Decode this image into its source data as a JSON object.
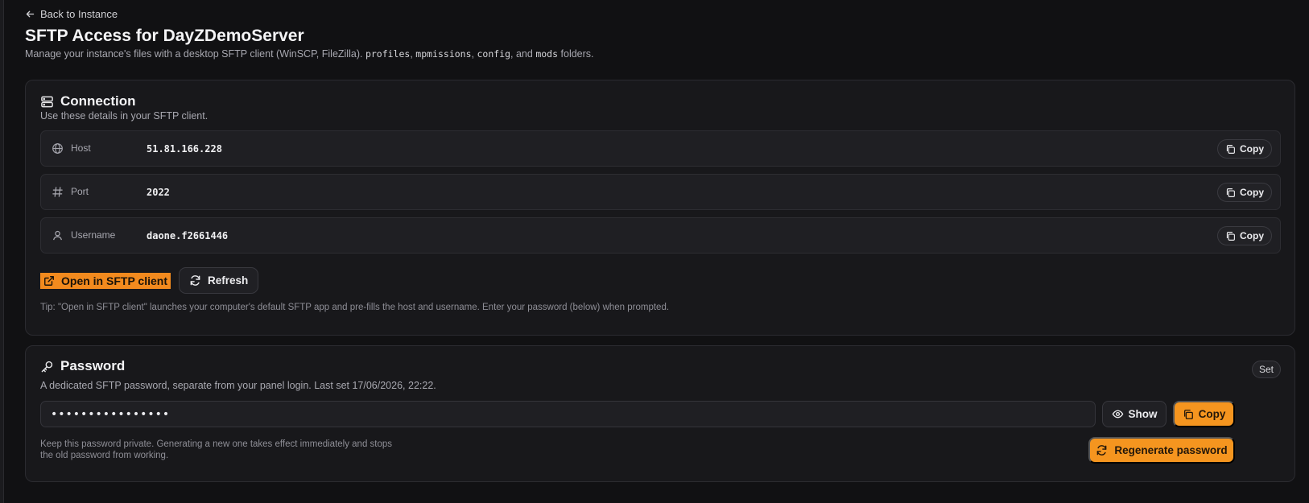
{
  "nav": {
    "back_label": "Back to Instance"
  },
  "header": {
    "title": "SFTP Access for DayZDemoServer",
    "subtitle_prefix": "Manage your instance's files with a desktop SFTP client (WinSCP, FileZilla).",
    "folders": [
      "profiles",
      "mpmissions",
      "config",
      "mods"
    ],
    "subtitle_and": "and",
    "subtitle_suffix": "folders."
  },
  "connection": {
    "title": "Connection",
    "description": "Use these details in your SFTP client.",
    "fields": [
      {
        "label": "Host",
        "value": "51.81.166.228",
        "icon": "globe-icon",
        "copy_label": "Copy"
      },
      {
        "label": "Port",
        "value": "2022",
        "icon": "hash-icon",
        "copy_label": "Copy"
      },
      {
        "label": "Username",
        "value": "daone.f2661446",
        "icon": "user-icon",
        "copy_label": "Copy"
      }
    ],
    "open_label": "Open in SFTP client",
    "refresh_label": "Refresh",
    "tip": "Tip: \"Open in SFTP client\" launches your computer's default SFTP app and pre-fills the host and username. Enter your password (below) when prompted."
  },
  "password": {
    "title": "Password",
    "status": "Set",
    "description": "A dedicated SFTP password, separate from your panel login. Last set 17/06/2026, 22:22.",
    "masked_value": "••••••••••••••••",
    "show_label": "Show",
    "copy_label": "Copy",
    "regenerate_label": "Regenerate password",
    "note": "Keep this password private. Generating a new one takes effect immediately and stops the old password from working."
  },
  "colors": {
    "accent": "#f5951f",
    "background": "#111113",
    "card": "#18181b"
  }
}
